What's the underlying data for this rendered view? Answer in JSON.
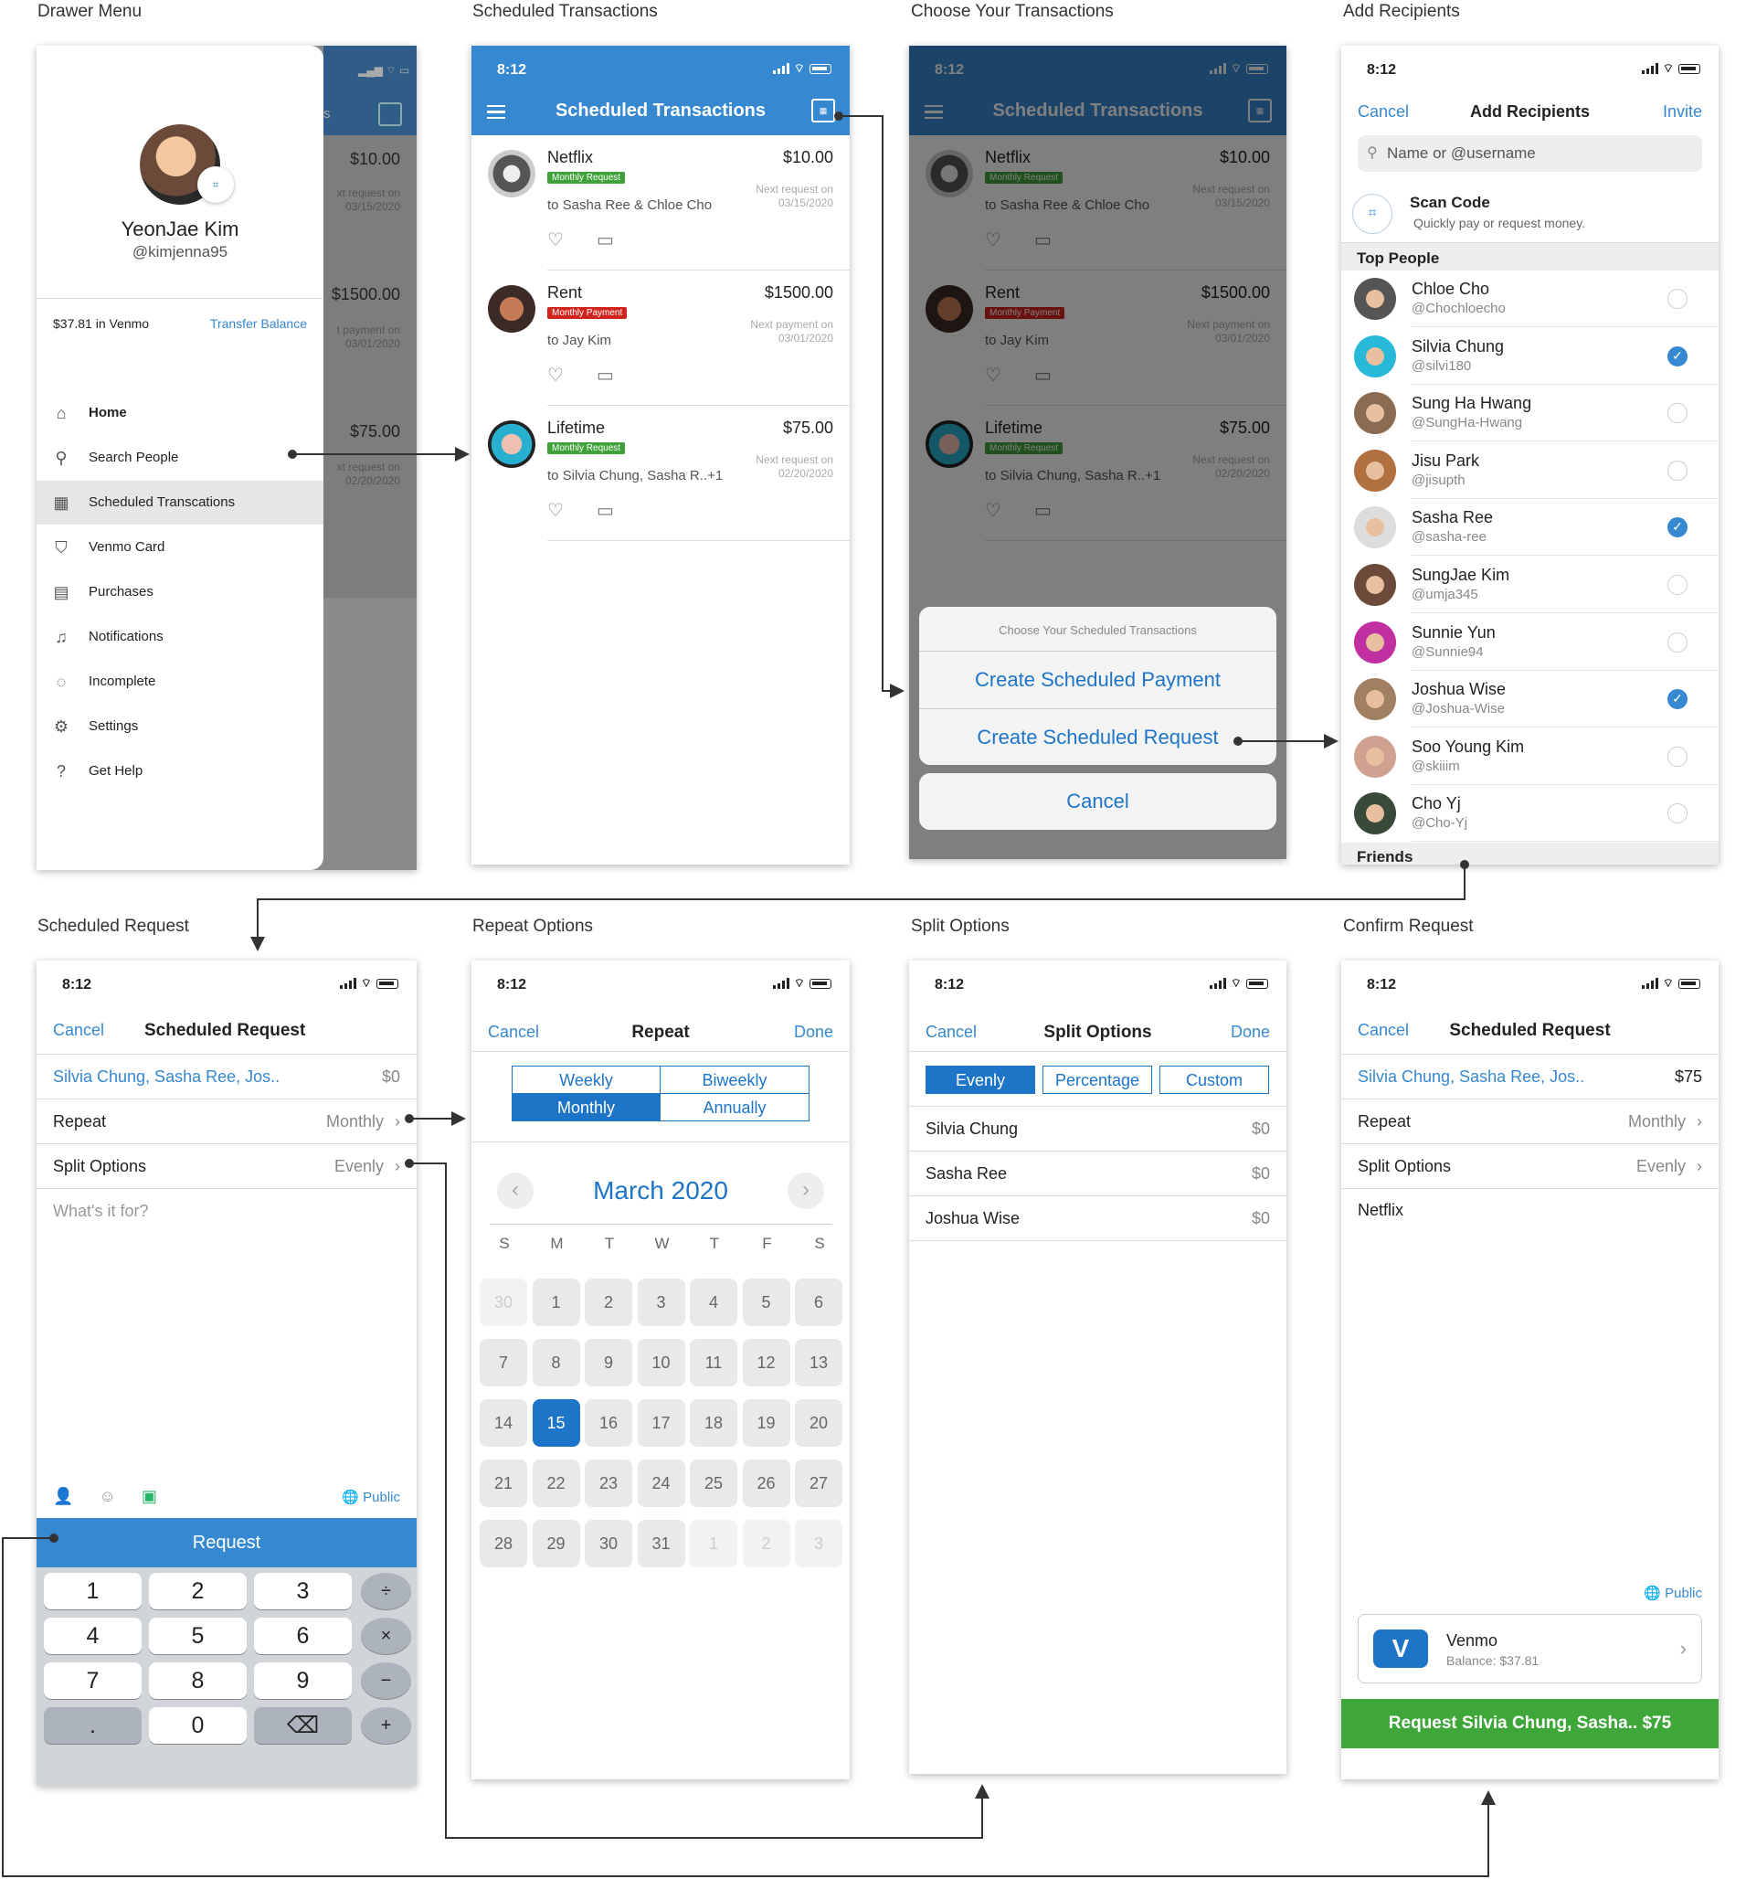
{
  "captions": {
    "c1": "Drawer Menu",
    "c2": "Scheduled Transactions",
    "c3": "Choose Your Transactions",
    "c4": "Add Recipients",
    "c5": "Scheduled Request",
    "c6": "Repeat Options",
    "c7": "Split Options",
    "c8": "Confirm Request"
  },
  "status_time": "8:12",
  "drawer": {
    "name": "YeonJae Kim",
    "handle": "@kimjenna95",
    "balance": "$37.81 in Venmo",
    "transfer": "Transfer Balance",
    "items": [
      {
        "label": "Home",
        "icon": "home-icon",
        "glyph": "⌂"
      },
      {
        "label": "Search People",
        "icon": "search-icon",
        "glyph": "⚲"
      },
      {
        "label": "Scheduled Transcations",
        "icon": "calendar-icon",
        "glyph": "▦"
      },
      {
        "label": "Venmo Card",
        "icon": "card-icon",
        "glyph": "⛉"
      },
      {
        "label": "Purchases",
        "icon": "receipt-icon",
        "glyph": "▤"
      },
      {
        "label": "Notifications",
        "icon": "bell-icon",
        "glyph": "♫"
      },
      {
        "label": "Incomplete",
        "icon": "pending-icon",
        "glyph": "◌"
      },
      {
        "label": "Settings",
        "icon": "gear-icon",
        "glyph": "⚙"
      },
      {
        "label": "Get Help",
        "icon": "help-icon",
        "glyph": "?"
      }
    ],
    "behind": {
      "amounts": [
        "$10.00",
        "$1500.00",
        "$75.00"
      ],
      "notes": [
        "xt request on",
        "03/15/2020",
        "t payment on",
        "03/01/2020",
        "xt request on",
        "02/20/2020"
      ],
      "frag": "s"
    }
  },
  "sched": {
    "title": "Scheduled Transactions",
    "tx": [
      {
        "name": "Netflix",
        "badge": "Monthly Request",
        "badge_color": "#3fa13a",
        "amount": "$10.00",
        "next1": "Next request on",
        "next2": "03/15/2020",
        "to": "to Sasha Ree & Chloe Cho"
      },
      {
        "name": "Rent",
        "badge": "Monthly Payment",
        "badge_color": "#d0231d",
        "amount": "$1500.00",
        "next1": "Next payment on",
        "next2": "03/01/2020",
        "to": "to Jay Kim"
      },
      {
        "name": "Lifetime",
        "badge": "Monthly Request",
        "badge_color": "#3fa13a",
        "amount": "$75.00",
        "next1": "Next request on",
        "next2": "02/20/2020",
        "to": "to Silvia Chung, Sasha R..+1"
      }
    ]
  },
  "sheet": {
    "title": "Choose Your Scheduled Transactions",
    "opt1": "Create Scheduled Payment",
    "opt2": "Create Scheduled Request",
    "cancel": "Cancel"
  },
  "recip": {
    "cancel": "Cancel",
    "title": "Add Recipients",
    "invite": "Invite",
    "search": "Name or @username",
    "scan_title": "Scan Code",
    "scan_sub": "Quickly pay or request money.",
    "top": "Top People",
    "friends": "Friends",
    "people": [
      {
        "n": "Chloe Cho",
        "h": "@Chochloecho",
        "on": false
      },
      {
        "n": "Silvia Chung",
        "h": "@silvi180",
        "on": true
      },
      {
        "n": "Sung Ha Hwang",
        "h": "@SungHa-Hwang",
        "on": false
      },
      {
        "n": "Jisu Park",
        "h": "@jisupth",
        "on": false
      },
      {
        "n": "Sasha Ree",
        "h": "@sasha-ree",
        "on": true
      },
      {
        "n": "SungJae Kim",
        "h": "@umja345",
        "on": false
      },
      {
        "n": "Sunnie Yun",
        "h": "@Sunnie94",
        "on": false
      },
      {
        "n": "Joshua Wise",
        "h": "@Joshua-Wise",
        "on": true
      },
      {
        "n": "Soo Young Kim",
        "h": "@skiiim",
        "on": false
      },
      {
        "n": "Cho Yj",
        "h": "@Cho-Yj",
        "on": false
      }
    ]
  },
  "req": {
    "cancel": "Cancel",
    "title": "Scheduled Request",
    "to": "Silvia Chung, Sasha Ree, Jos..",
    "amt": "$0",
    "repeat": "Repeat",
    "repeat_v": "Monthly",
    "split": "Split Options",
    "split_v": "Evenly",
    "note": "What's it for?",
    "public": "Public",
    "button": "Request",
    "keys": [
      "1",
      "2",
      "3",
      "÷",
      "4",
      "5",
      "6",
      "×",
      "7",
      "8",
      "9",
      "−",
      ".",
      "0",
      "⌫",
      "+"
    ]
  },
  "repeat": {
    "cancel": "Cancel",
    "title": "Repeat",
    "done": "Done",
    "segs": [
      "Weekly",
      "Biweekly",
      "Monthly",
      "Annually"
    ],
    "month": "March 2020",
    "dow": [
      "S",
      "M",
      "T",
      "W",
      "T",
      "F",
      "S"
    ],
    "days": [
      "30",
      "1",
      "2",
      "3",
      "4",
      "5",
      "6",
      "7",
      "8",
      "9",
      "10",
      "11",
      "12",
      "13",
      "14",
      "15",
      "16",
      "17",
      "18",
      "19",
      "20",
      "21",
      "22",
      "23",
      "24",
      "25",
      "26",
      "27",
      "28",
      "29",
      "30",
      "31",
      "1",
      "2",
      "3"
    ]
  },
  "split": {
    "cancel": "Cancel",
    "title": "Split Options",
    "done": "Done",
    "segs": [
      "Evenly",
      "Percentage",
      "Custom"
    ],
    "rows": [
      {
        "n": "Silvia Chung",
        "v": "$0"
      },
      {
        "n": "Sasha Ree",
        "v": "$0"
      },
      {
        "n": "Joshua Wise",
        "v": "$0"
      }
    ]
  },
  "confirm": {
    "cancel": "Cancel",
    "title": "Scheduled Request",
    "to": "Silvia Chung, Sasha Ree, Jos..",
    "amt": "$75",
    "repeat": "Repeat",
    "repeat_v": "Monthly",
    "split": "Split Options",
    "split_v": "Evenly",
    "note": "Netflix",
    "public": "Public",
    "venmo": "Venmo",
    "balance": "Balance: $37.81",
    "button": "Request Silvia Chung, Sasha.. $75"
  }
}
